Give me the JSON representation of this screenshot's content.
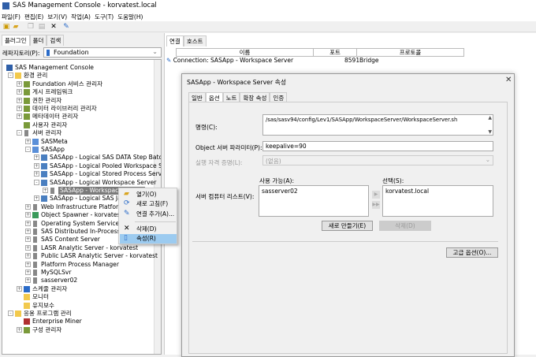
{
  "window": {
    "title": "SAS Management Console - korvatest.local"
  },
  "menu": [
    "파일(F)",
    "편집(E)",
    "보기(V)",
    "작업(A)",
    "도구(T)",
    "도움말(H)"
  ],
  "left": {
    "tabs": [
      "플러그인",
      "폴더",
      "검색"
    ],
    "repo_label": "레파지토리(P):",
    "repo_value": "Foundation"
  },
  "tree": [
    {
      "label": "SAS Management Console",
      "lvl": 0,
      "exp": "",
      "icon": "console"
    },
    {
      "label": "환경 관리",
      "lvl": 1,
      "exp": "-",
      "icon": "folder"
    },
    {
      "label": "Foundation 서비스 관리자",
      "lvl": 2,
      "exp": "+",
      "icon": "plugin"
    },
    {
      "label": "게시 프레임워크",
      "lvl": 2,
      "exp": "+",
      "icon": "plugin"
    },
    {
      "label": "권한 관리자",
      "lvl": 2,
      "exp": "+",
      "icon": "plugin"
    },
    {
      "label": "데이터 라이브러리 관리자",
      "lvl": 2,
      "exp": "+",
      "icon": "plugin"
    },
    {
      "label": "메타데이터 관리자",
      "lvl": 2,
      "exp": "+",
      "icon": "plugin"
    },
    {
      "label": "사용자 관리자",
      "lvl": 2,
      "exp": "",
      "icon": "plugin"
    },
    {
      "label": "서버 관리자",
      "lvl": 2,
      "exp": "-",
      "icon": "server"
    },
    {
      "label": "SASMeta",
      "lvl": 3,
      "exp": "+",
      "icon": "cluster"
    },
    {
      "label": "SASApp",
      "lvl": 3,
      "exp": "-",
      "icon": "cluster"
    },
    {
      "label": "SASApp - Logical SAS DATA Step Batch Ser",
      "lvl": 4,
      "exp": "+",
      "icon": "logical"
    },
    {
      "label": "SASApp - Logical Pooled Workspace Server",
      "lvl": 4,
      "exp": "+",
      "icon": "logical"
    },
    {
      "label": "SASApp - Logical Stored Process Server",
      "lvl": 4,
      "exp": "+",
      "icon": "logical"
    },
    {
      "label": "SASApp - Logical Workspace Server",
      "lvl": 4,
      "exp": "-",
      "icon": "logical"
    },
    {
      "label": "SASApp - Workspace Server",
      "lvl": 5,
      "exp": "+",
      "icon": "server",
      "selected": true
    },
    {
      "label": "SASApp - Logical SAS Java",
      "lvl": 4,
      "exp": "+",
      "icon": "logical"
    },
    {
      "label": "Web Infrastructure Platform Data",
      "lvl": 3,
      "exp": "+",
      "icon": "server"
    },
    {
      "label": "Object Spawner - korvatest",
      "lvl": 3,
      "exp": "+",
      "icon": "spawner"
    },
    {
      "label": "Operating System Services - ko",
      "lvl": 3,
      "exp": "+",
      "icon": "server"
    },
    {
      "label": "SAS Distributed In-Process Serv",
      "lvl": 3,
      "exp": "+",
      "icon": "server"
    },
    {
      "label": "SAS Content Server",
      "lvl": 3,
      "exp": "+",
      "icon": "server"
    },
    {
      "label": "LASR Analytic Server - korvatest",
      "lvl": 3,
      "exp": "+",
      "icon": "server"
    },
    {
      "label": "Public LASR Analytic Server - korvatest",
      "lvl": 3,
      "exp": "+",
      "icon": "server"
    },
    {
      "label": "Platform Process Manager",
      "lvl": 3,
      "exp": "+",
      "icon": "server"
    },
    {
      "label": "MySQLSvr",
      "lvl": 3,
      "exp": "+",
      "icon": "server"
    },
    {
      "label": "sasserver02",
      "lvl": 3,
      "exp": "+",
      "icon": "server"
    },
    {
      "label": "스케줄 관리자",
      "lvl": 2,
      "exp": "+",
      "icon": "clock"
    },
    {
      "label": "모니터",
      "lvl": 2,
      "exp": "",
      "icon": "folder"
    },
    {
      "label": "유지보수",
      "lvl": 2,
      "exp": "",
      "icon": "folder"
    },
    {
      "label": "응용 프로그램 관리",
      "lvl": 1,
      "exp": "-",
      "icon": "folder"
    },
    {
      "label": "Enterprise Miner",
      "lvl": 2,
      "exp": "",
      "icon": "em"
    },
    {
      "label": "구성 관리자",
      "lvl": 2,
      "exp": "+",
      "icon": "plugin"
    }
  ],
  "right": {
    "tabs": [
      "연결",
      "호스트"
    ],
    "columns": [
      "이름",
      "포트",
      "프로토콜"
    ],
    "row": {
      "name": "Connection: SASApp - Workspace Server",
      "port": "8591",
      "protocol": "Bridge"
    }
  },
  "context_menu": [
    {
      "label": "열기(O)",
      "icon": "open-folder"
    },
    {
      "label": "새로 고침(F)",
      "icon": "refresh"
    },
    {
      "label": "연결 추가(A)...",
      "icon": "add-connection"
    },
    {
      "label": "삭제(D)",
      "icon": "delete"
    },
    {
      "label": "속성(R)",
      "icon": "properties"
    }
  ],
  "dialog": {
    "title": "SASApp - Workspace Server 속성",
    "tabs": [
      "일반",
      "옵션",
      "노트",
      "확장 속성",
      "인증"
    ],
    "command_label": "명령(C):",
    "command_value": "/sas/sasv94/config/Lev1/SASApp/WorkspaceServer/WorkspaceServer.sh",
    "params_label": "Object 서버 파라미터(P):",
    "params_value": "keepalive=90",
    "cred_label": "실행 자격 증명(L):",
    "cred_value": "(없음)",
    "list_label": "서버 컴퓨터 리스트(V):",
    "available_label": "사용 가능(A):",
    "available": [
      "sasserver02"
    ],
    "selected_label": "선택(S):",
    "selected": [
      "korvatest.local"
    ],
    "new_button": "새로 만들기(E)",
    "delete_button": "삭제(D)",
    "advanced_button": "고급 옵션(O)..."
  }
}
